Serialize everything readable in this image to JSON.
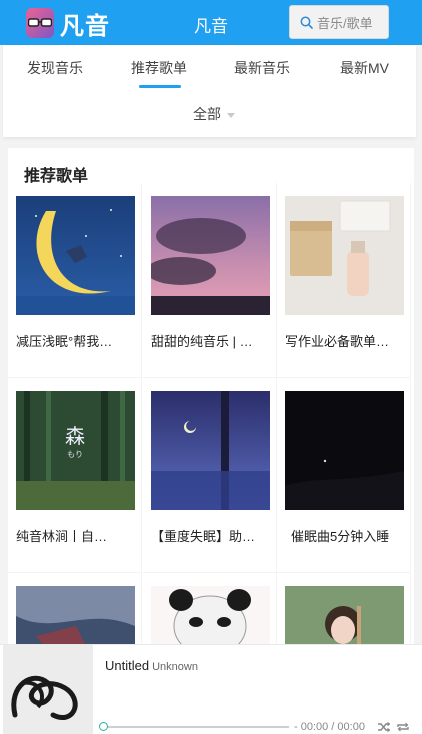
{
  "header": {
    "logo_text": "凡音",
    "title": "凡音",
    "search_label": "音乐/歌单"
  },
  "tabs": [
    {
      "label": "发现音乐",
      "active": false
    },
    {
      "label": "推荐歌单",
      "active": true
    },
    {
      "label": "最新音乐",
      "active": false
    },
    {
      "label": "最新MV",
      "active": false
    }
  ],
  "filter": {
    "label": "全部"
  },
  "section": {
    "title": "推荐歌单"
  },
  "playlists": [
    {
      "title": "减压浅眠°帮我…"
    },
    {
      "title": "甜甜的纯音乐 | …"
    },
    {
      "title": "写作业必备歌单…"
    },
    {
      "title": "纯音林涧丨自…"
    },
    {
      "title": "【重度失眠】助…"
    },
    {
      "title": "催眠曲5分钟入睡"
    },
    {
      "title": ""
    },
    {
      "title": ""
    },
    {
      "title": ""
    }
  ],
  "player": {
    "track": "Untitled",
    "artist": "Unknown",
    "time": "- 00:00 / 00:00",
    "progress": 0
  },
  "colors": {
    "accent": "#20a0f0",
    "progress_knob": "#2ab4a0"
  },
  "icons": [
    "logo-glasses-icon",
    "search-icon",
    "caret-down-icon",
    "shuffle-icon",
    "repeat-icon"
  ]
}
